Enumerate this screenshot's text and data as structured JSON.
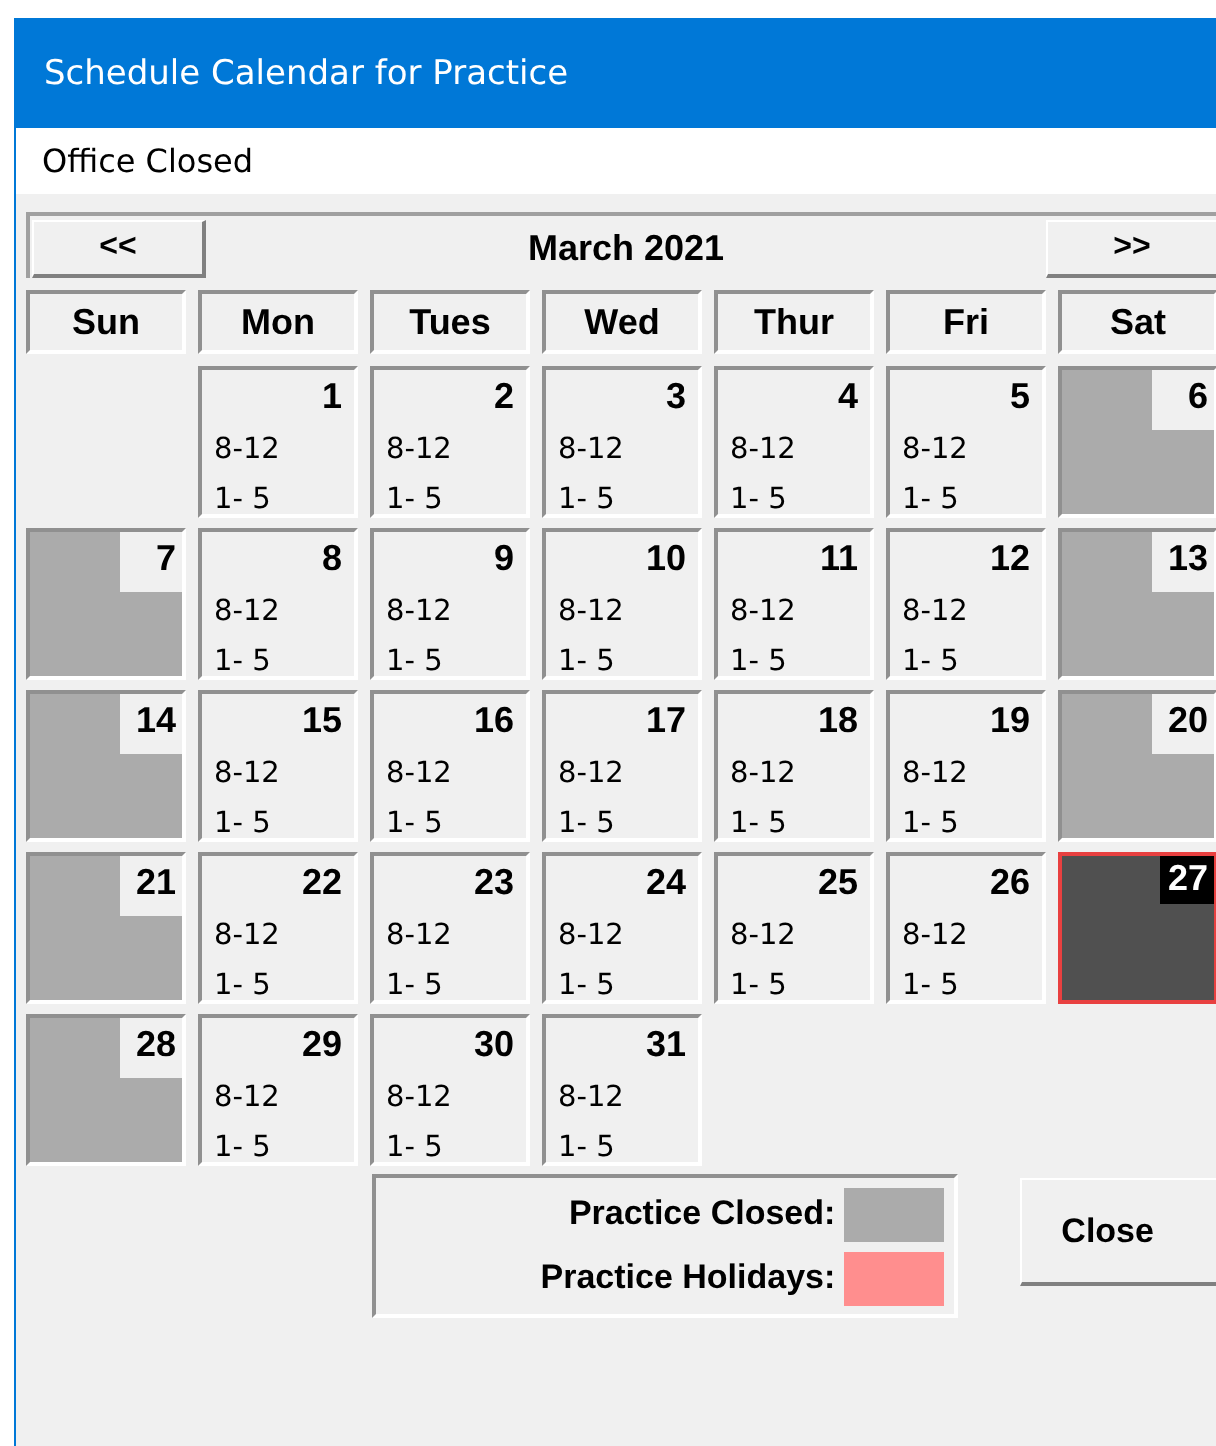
{
  "window": {
    "title": "Schedule Calendar for Practice"
  },
  "status": "Office Closed",
  "nav": {
    "prev": "<<",
    "month": "March 2021",
    "next": ">>"
  },
  "weekdays": [
    "Sun",
    "Mon",
    "Tues",
    "Wed",
    "Thur",
    "Fri",
    "Sat"
  ],
  "weeks": [
    [
      {
        "kind": "blank"
      },
      {
        "kind": "open",
        "day": "1",
        "hours": [
          "8-12",
          "1- 5"
        ],
        "selected": false
      },
      {
        "kind": "open",
        "day": "2",
        "hours": [
          "8-12",
          "1- 5"
        ],
        "selected": false
      },
      {
        "kind": "open",
        "day": "3",
        "hours": [
          "8-12",
          "1- 5"
        ],
        "selected": false
      },
      {
        "kind": "open",
        "day": "4",
        "hours": [
          "8-12",
          "1- 5"
        ],
        "selected": false
      },
      {
        "kind": "open",
        "day": "5",
        "hours": [
          "8-12",
          "1- 5"
        ],
        "selected": false
      },
      {
        "kind": "closed",
        "day": "6",
        "selected": false
      }
    ],
    [
      {
        "kind": "closed",
        "day": "7",
        "selected": false
      },
      {
        "kind": "open",
        "day": "8",
        "hours": [
          "8-12",
          "1- 5"
        ],
        "selected": false
      },
      {
        "kind": "open",
        "day": "9",
        "hours": [
          "8-12",
          "1- 5"
        ],
        "selected": false
      },
      {
        "kind": "open",
        "day": "10",
        "hours": [
          "8-12",
          "1- 5"
        ],
        "selected": false
      },
      {
        "kind": "open",
        "day": "11",
        "hours": [
          "8-12",
          "1- 5"
        ],
        "selected": false
      },
      {
        "kind": "open",
        "day": "12",
        "hours": [
          "8-12",
          "1- 5"
        ],
        "selected": false
      },
      {
        "kind": "closed",
        "day": "13",
        "selected": false
      }
    ],
    [
      {
        "kind": "closed",
        "day": "14",
        "selected": false
      },
      {
        "kind": "open",
        "day": "15",
        "hours": [
          "8-12",
          "1- 5"
        ],
        "selected": false
      },
      {
        "kind": "open",
        "day": "16",
        "hours": [
          "8-12",
          "1- 5"
        ],
        "selected": false
      },
      {
        "kind": "open",
        "day": "17",
        "hours": [
          "8-12",
          "1- 5"
        ],
        "selected": false
      },
      {
        "kind": "open",
        "day": "18",
        "hours": [
          "8-12",
          "1- 5"
        ],
        "selected": false
      },
      {
        "kind": "open",
        "day": "19",
        "hours": [
          "8-12",
          "1- 5"
        ],
        "selected": false
      },
      {
        "kind": "closed",
        "day": "20",
        "selected": false
      }
    ],
    [
      {
        "kind": "closed",
        "day": "21",
        "selected": false
      },
      {
        "kind": "open",
        "day": "22",
        "hours": [
          "8-12",
          "1- 5"
        ],
        "selected": false
      },
      {
        "kind": "open",
        "day": "23",
        "hours": [
          "8-12",
          "1- 5"
        ],
        "selected": false
      },
      {
        "kind": "open",
        "day": "24",
        "hours": [
          "8-12",
          "1- 5"
        ],
        "selected": false
      },
      {
        "kind": "open",
        "day": "25",
        "hours": [
          "8-12",
          "1- 5"
        ],
        "selected": false
      },
      {
        "kind": "open",
        "day": "26",
        "hours": [
          "8-12",
          "1- 5"
        ],
        "selected": false
      },
      {
        "kind": "closed",
        "day": "27",
        "selected": true
      }
    ],
    [
      {
        "kind": "closed",
        "day": "28",
        "selected": false
      },
      {
        "kind": "open",
        "day": "29",
        "hours": [
          "8-12",
          "1- 5"
        ],
        "selected": false
      },
      {
        "kind": "open",
        "day": "30",
        "hours": [
          "8-12",
          "1- 5"
        ],
        "selected": false
      },
      {
        "kind": "open",
        "day": "31",
        "hours": [
          "8-12",
          "1- 5"
        ],
        "selected": false
      },
      {
        "kind": "blank"
      },
      {
        "kind": "blank"
      },
      {
        "kind": "blank"
      }
    ]
  ],
  "legend": [
    {
      "label": "Practice Closed:",
      "color": "#ababab"
    },
    {
      "label": "Practice Holidays:",
      "color": "#ff8e8e"
    }
  ],
  "close_button": "Close"
}
